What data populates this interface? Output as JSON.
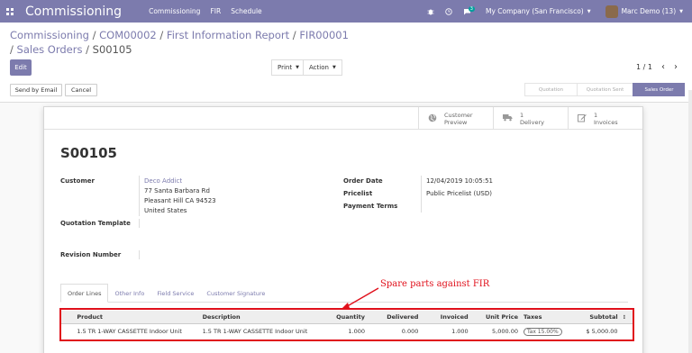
{
  "topbar": {
    "app_name": "Commissioning",
    "nav": [
      "Commissioning",
      "FIR",
      "Schedule"
    ],
    "chat_badge": "3",
    "company": "My Company (San Francisco)",
    "user": "Marc Demo (13)"
  },
  "breadcrumb": {
    "items": [
      "Commissioning",
      "COM00002",
      "First Information Report",
      "FIR00001",
      "Sales Orders"
    ],
    "current": "S00105"
  },
  "toolbar": {
    "edit": "Edit",
    "print": "Print",
    "action": "Action",
    "pager": "1 / 1",
    "send_email": "Send by Email",
    "cancel": "Cancel"
  },
  "stages": [
    "Quotation",
    "Quotation Sent",
    "Sales Order"
  ],
  "smart_buttons": [
    {
      "icon": "globe-icon",
      "line1": "Customer",
      "line2": "Preview"
    },
    {
      "icon": "truck-icon",
      "line1": "1",
      "line2": "Delivery"
    },
    {
      "icon": "edit-icon",
      "line1": "1",
      "line2": "Invoices"
    }
  ],
  "document": {
    "title": "S00105",
    "customer_label": "Customer",
    "customer_name": "Deco Addict",
    "address": [
      "77 Santa Barbara Rd",
      "Pleasant Hill CA 94523",
      "United States"
    ],
    "template_label": "Quotation Template",
    "revision_label": "Revision Number",
    "order_date_label": "Order Date",
    "order_date": "12/04/2019 10:05:51",
    "pricelist_label": "Pricelist",
    "pricelist": "Public Pricelist (USD)",
    "payment_terms_label": "Payment Terms"
  },
  "tabs": [
    "Order Lines",
    "Other Info",
    "Field Service",
    "Customer Signature"
  ],
  "table": {
    "headers": [
      "Product",
      "Description",
      "Quantity",
      "Delivered",
      "Invoiced",
      "Unit Price",
      "Taxes",
      "Subtotal"
    ],
    "rows": [
      {
        "product": "1.5 TR 1-WAY CASSETTE Indoor Unit",
        "description": "1.5 TR 1-WAY CASSETTE Indoor Unit",
        "quantity": "1.000",
        "delivered": "0.000",
        "invoiced": "1.000",
        "unit_price": "5,000.00",
        "taxes": "Tax 15.00%",
        "subtotal": "$ 5,000.00"
      }
    ]
  },
  "annotation": "Spare parts against FIR",
  "colors": {
    "brand": "#7c7bad",
    "annotation": "#e0101b"
  }
}
